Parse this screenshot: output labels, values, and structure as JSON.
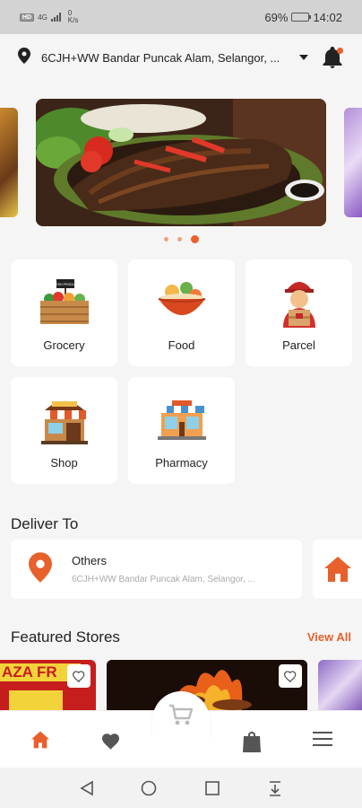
{
  "status_bar": {
    "sim_label": "HD",
    "network": "4G",
    "speed_value": "0",
    "speed_unit": "K/s",
    "battery_percent": "69%",
    "battery_level": 0.69,
    "time": "14:02"
  },
  "header": {
    "address": "6CJH+WW Bandar Puncak Alam, Selangor, ...",
    "has_notification": true
  },
  "carousel": {
    "slide_count": 3,
    "active_index": 2
  },
  "categories": [
    {
      "label": "Grocery",
      "icon": "grocery-stand-icon",
      "sign_text": "FRESH PRODUCE"
    },
    {
      "label": "Food",
      "icon": "food-bowl-icon"
    },
    {
      "label": "Parcel",
      "icon": "delivery-courier-icon"
    },
    {
      "label": "Shop",
      "icon": "shop-storefront-icon"
    },
    {
      "label": "Pharmacy",
      "icon": "pharmacy-storefront-icon"
    }
  ],
  "deliver_to": {
    "title": "Deliver To",
    "name": "Others",
    "address": "6CJH+WW Bandar Puncak Alam, Selangor, ..."
  },
  "featured": {
    "title": "Featured Stores",
    "view_all": "View All",
    "first_store_banner": "AZA FR"
  },
  "bottom_nav": {
    "items": [
      "home-icon",
      "heart-icon",
      "cart-icon",
      "bag-icon",
      "menu-icon"
    ],
    "active": "home-icon"
  },
  "colors": {
    "accent": "#e8602c",
    "inactive_nav": "#555555",
    "background": "#f5f5f5"
  }
}
